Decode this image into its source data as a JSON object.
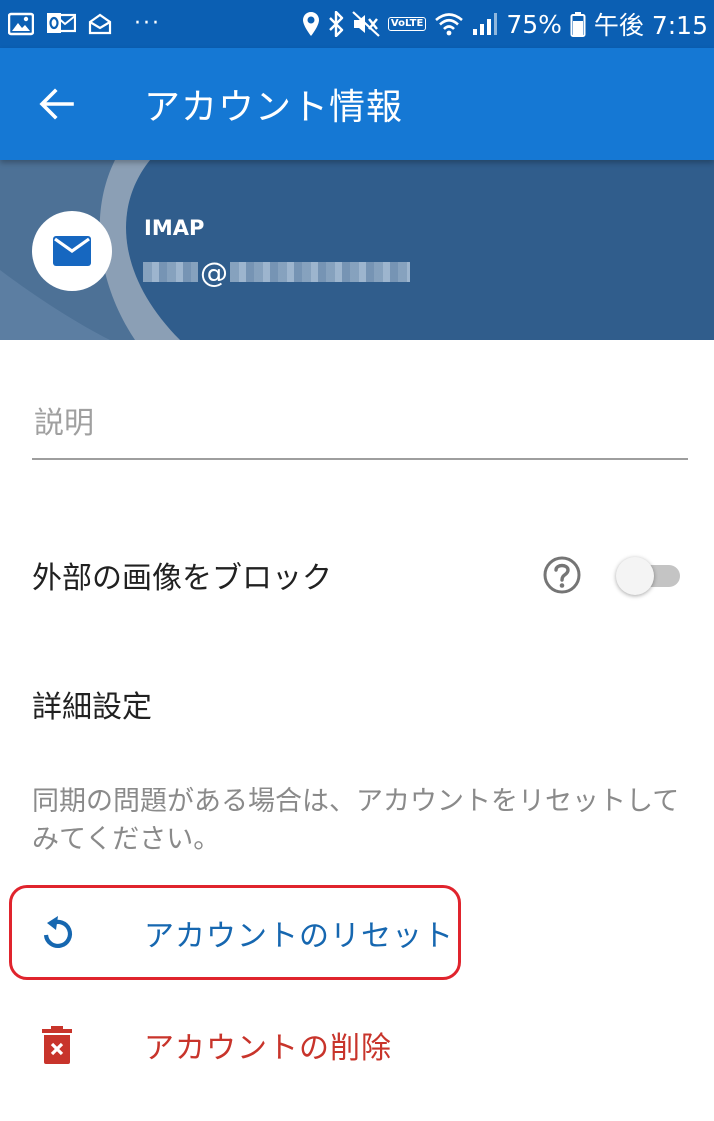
{
  "status_bar": {
    "battery_percent": "75%",
    "time": "午後 7:15",
    "volte_label": "VoLTE",
    "left_icons": [
      "gallery-icon",
      "outlook-icon",
      "mail-icon"
    ],
    "right_icons": [
      "location-icon",
      "bluetooth-icon",
      "mute-icon",
      "volte-icon",
      "wifi-icon",
      "signal-icon",
      "battery-icon"
    ],
    "bar_color": "#0b5fb3"
  },
  "app_bar": {
    "title": "アカウント情報",
    "back_icon": "arrow-back-icon",
    "color": "#1578d4"
  },
  "account": {
    "type": "IMAP",
    "email_at": "@",
    "avatar_icon": "envelope-icon",
    "banner_color": "#305d8c"
  },
  "description_field": {
    "placeholder": "説明",
    "value": ""
  },
  "block_external_images": {
    "label": "外部の画像をブロック",
    "help_icon": "help-circle-icon",
    "enabled": false
  },
  "advanced": {
    "heading": "詳細設定"
  },
  "reset_hint": "同期の問題がある場合は、アカウントをリセットしてみてください。",
  "actions": {
    "reset": {
      "label": "アカウントのリセット",
      "icon": "reset-icon",
      "color": "#1667b0"
    },
    "delete": {
      "label": "アカウントの削除",
      "icon": "trash-icon",
      "color": "#c8342b"
    }
  },
  "highlight_color": "#e0242d"
}
